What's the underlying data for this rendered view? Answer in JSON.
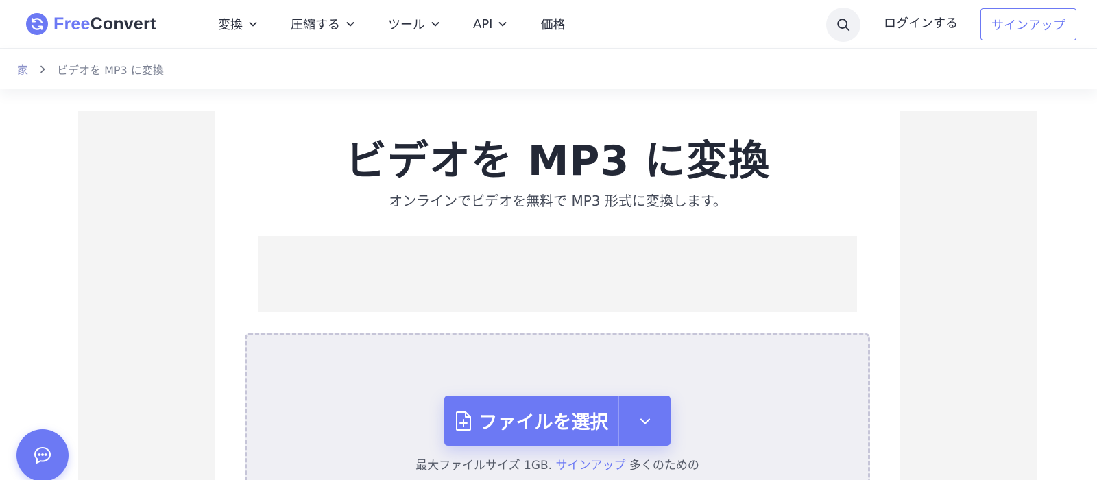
{
  "header": {
    "logo": {
      "free": "Free",
      "convert": "Convert"
    },
    "nav": [
      {
        "label": "変換",
        "has_dropdown": true
      },
      {
        "label": "圧縮する",
        "has_dropdown": true
      },
      {
        "label": "ツール",
        "has_dropdown": true
      },
      {
        "label": "API",
        "has_dropdown": true
      },
      {
        "label": "価格",
        "has_dropdown": false
      }
    ],
    "search_icon": "search-icon",
    "login_label": "ログインする",
    "signup_label": "サインアップ"
  },
  "breadcrumb": {
    "home": "家",
    "current": "ビデオを MP3 に変換"
  },
  "main": {
    "title": "ビデオを MP3 に変換",
    "subtitle": "オンラインでビデオを無料で MP3 形式に変換します。",
    "choose_file_label": "ファイルを選択",
    "max_size_prefix": "最大ファイルサイズ 1GB.",
    "max_size_link": "サインアップ",
    "max_size_suffix": "多くのための"
  },
  "chat": {
    "icon": "chat-icon"
  },
  "colors": {
    "accent": "#6c79f4",
    "text_dark": "#232836",
    "dropzone_bg": "#efeff4",
    "dropzone_border": "#c6c5d8",
    "ad_bg": "#f4f4f4"
  }
}
